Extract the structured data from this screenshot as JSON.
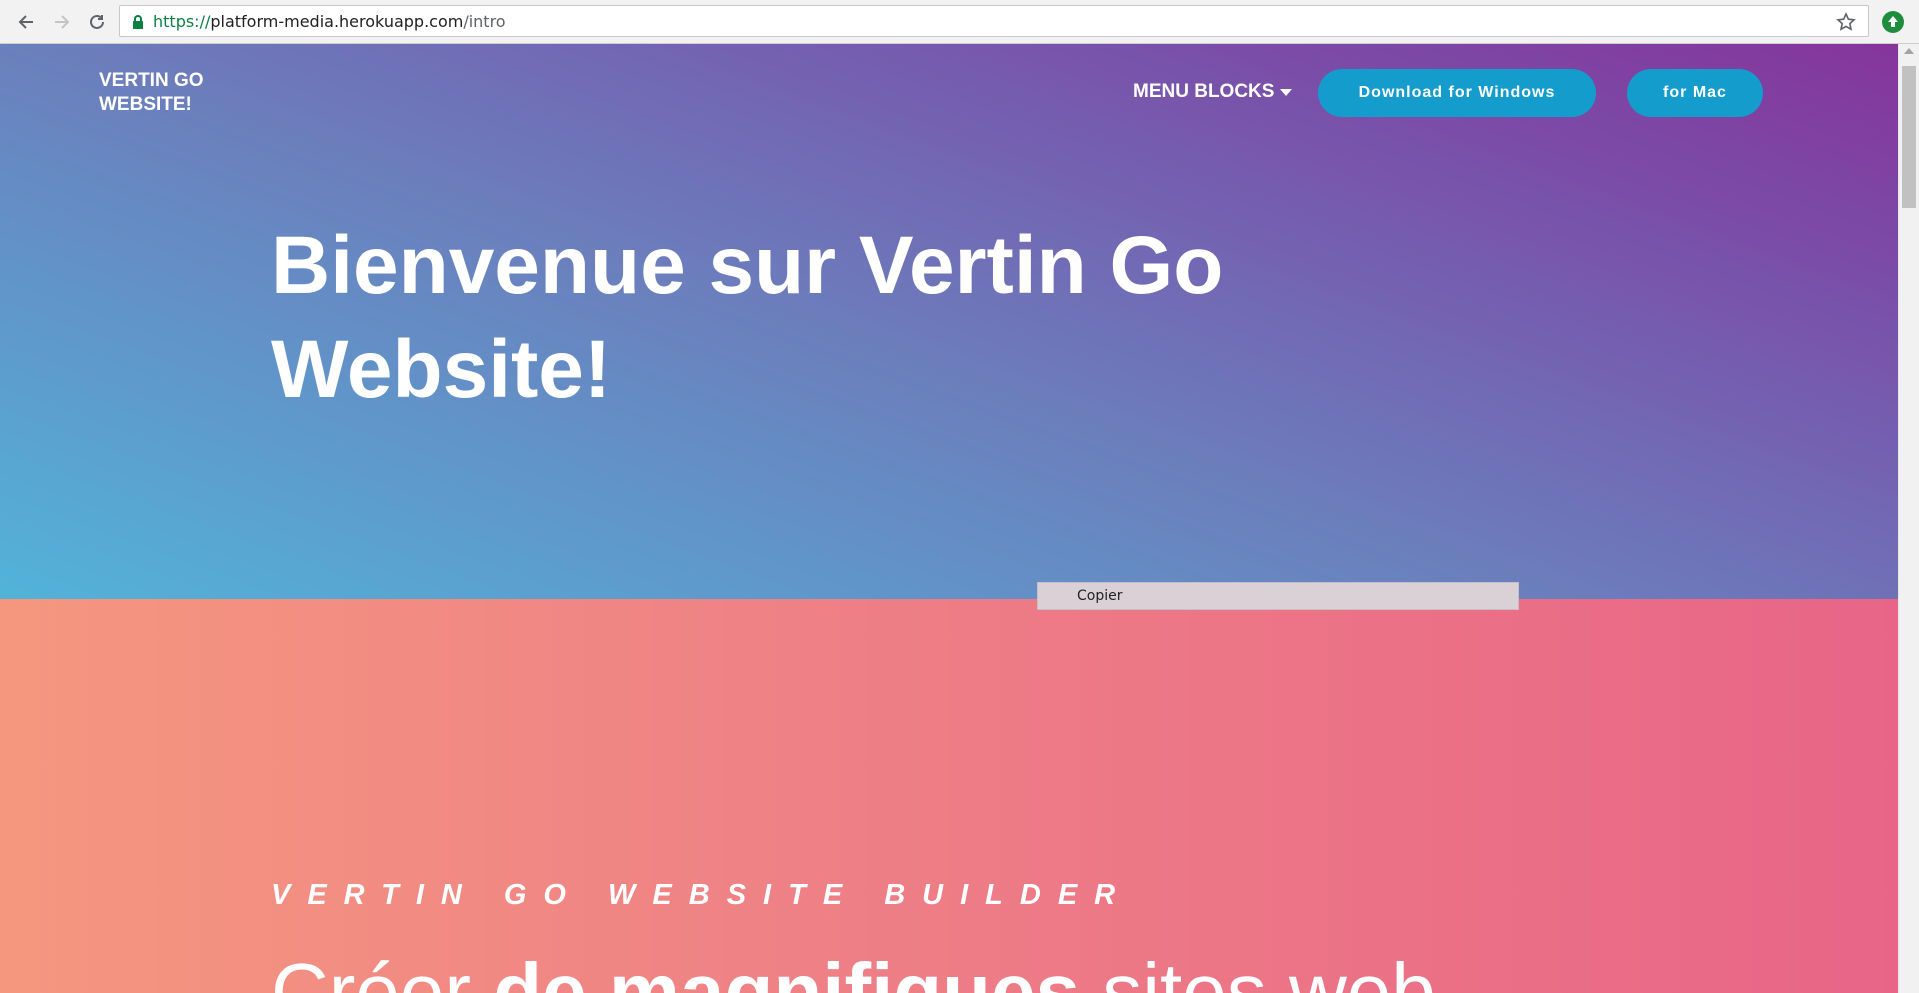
{
  "browser": {
    "url_scheme": "https://",
    "url_host": "platform-media.herokuapp.com",
    "url_path": "/intro"
  },
  "nav": {
    "brand": "VERTIN GO WEBSITE!",
    "menu_label": "MENU BLOCKS",
    "download_windows": "Download for Windows",
    "download_mac": "for Mac"
  },
  "hero": {
    "title": "Bienvenue sur Vertin Go Website!"
  },
  "section2": {
    "eyebrow": "VERTIN GO WEBSITE BUILDER",
    "tagline_light_1": "Créer ",
    "tagline_bold": "de magnifiques",
    "tagline_light_2": " sites web"
  },
  "context_menu": {
    "copy_label": "Copier"
  },
  "colors": {
    "hero_gradient_start": "#52b3d9",
    "hero_gradient_end": "#85359b",
    "section2_gradient_start": "#f5977f",
    "section2_gradient_end": "#e86587",
    "button": "#149dcc"
  }
}
